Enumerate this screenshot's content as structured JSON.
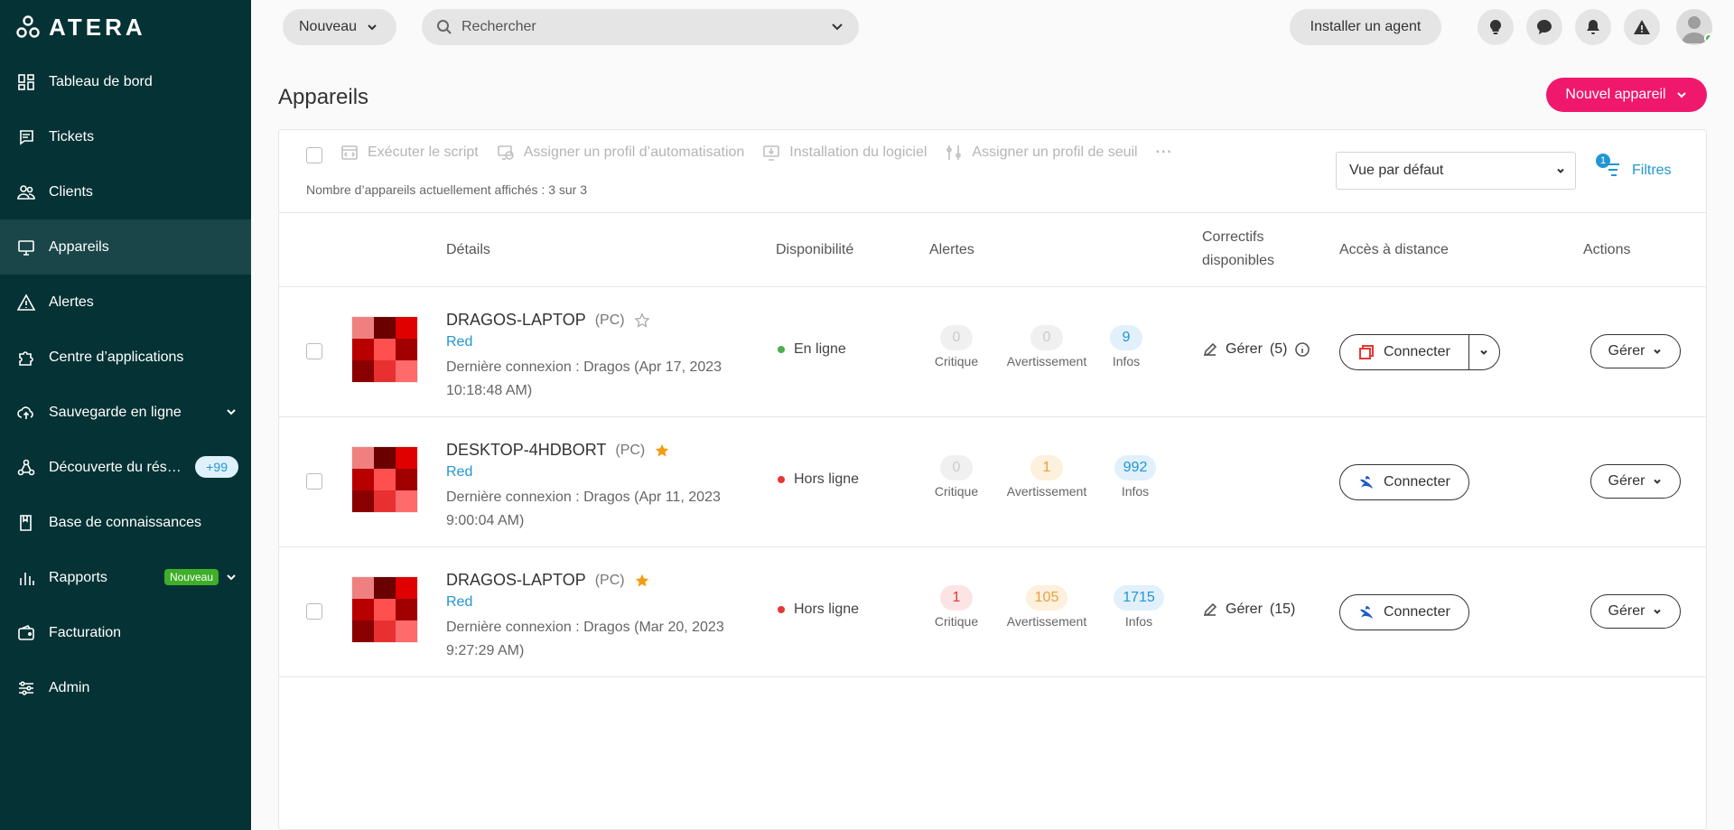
{
  "brand": {
    "name": "ATERA"
  },
  "sidebar": {
    "items": [
      {
        "label": "Tableau de bord"
      },
      {
        "label": "Tickets"
      },
      {
        "label": "Clients"
      },
      {
        "label": "Appareils"
      },
      {
        "label": "Alertes"
      },
      {
        "label": "Centre d’applications"
      },
      {
        "label": "Sauvegarde en ligne"
      },
      {
        "label": "Découverte du rés…",
        "badge": "+99"
      },
      {
        "label": "Base de connaissances"
      },
      {
        "label": "Rapports",
        "badge": "Nouveau"
      },
      {
        "label": "Facturation"
      },
      {
        "label": "Admin"
      }
    ]
  },
  "header": {
    "new_label": "Nouveau",
    "search_placeholder": "Rechercher",
    "install_agent": "Installer un agent"
  },
  "page": {
    "title": "Appareils",
    "new_device": "Nouvel appareil"
  },
  "toolbar": {
    "actions": [
      "Exécuter le script",
      "Assigner un profil d’automatisation",
      "Installation du logiciel",
      "Assigner un profil de seuil"
    ],
    "more": "···",
    "count_text": "Nombre d’appareils actuellement affichés : 3 sur 3",
    "view": "Vue par défaut",
    "filters_label": "Filtres",
    "filters_count": "1"
  },
  "table": {
    "headers": {
      "details": "Détails",
      "availability": "Disponibilité",
      "alerts": "Alertes",
      "patches_line1": "Correctifs",
      "patches_line2": "disponibles",
      "remote": "Accès à distance",
      "actions": "Actions"
    },
    "alert_labels": {
      "critical": "Critique",
      "warning": "Avertissement",
      "info": "Infos"
    },
    "rows": [
      {
        "name": "DRAGOS-LAPTOP",
        "type": "(PC)",
        "starred": false,
        "customer": "Red",
        "last_login": "Dernière connexion : Dragos (Apr 17, 2023 10:18:48 AM)",
        "status": "En ligne",
        "status_color": "#4caf50",
        "critical": "0",
        "warning": "0",
        "info": "9",
        "patch": "Gérer",
        "patch_count": "(5)",
        "connect": "Connecter",
        "manage": "Gérer"
      },
      {
        "name": "DESKTOP-4HDBORT",
        "type": "(PC)",
        "starred": true,
        "customer": "Red",
        "last_login": "Dernière connexion : Dragos (Apr 11, 2023 9:00:04 AM)",
        "status": "Hors ligne",
        "status_color": "#e53935",
        "critical": "0",
        "warning": "1",
        "info": "992",
        "patch": "",
        "patch_count": "",
        "connect": "Connecter",
        "manage": "Gérer"
      },
      {
        "name": "DRAGOS-LAPTOP",
        "type": "(PC)",
        "starred": true,
        "customer": "Red",
        "last_login": "Dernière connexion : Dragos (Mar 20, 2023 9:27:29 AM)",
        "status": "Hors ligne",
        "status_color": "#e53935",
        "critical": "1",
        "warning": "105",
        "info": "1715",
        "patch": "Gérer",
        "patch_count": "(15)",
        "connect": "Connecter",
        "manage": "Gérer"
      }
    ]
  },
  "colors": {
    "sidebar": "#053235",
    "accent": "#f0186c",
    "link": "#2196d3",
    "star": "#f39c12"
  }
}
